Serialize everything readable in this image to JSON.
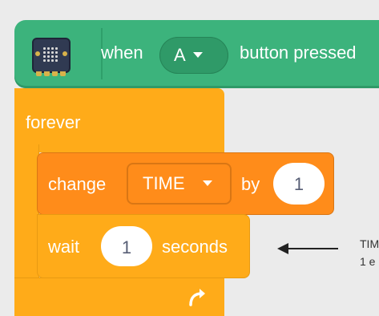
{
  "hat_block": {
    "word_when": "when",
    "button_value": "A",
    "word_button_pressed": "button pressed"
  },
  "forever_block": {
    "label": "forever"
  },
  "change_block": {
    "word_change": "change",
    "variable": "TIME",
    "word_by": "by",
    "value": "1"
  },
  "wait_block": {
    "word_wait": "wait",
    "value": "1",
    "word_seconds": "seconds"
  },
  "annotation": {
    "line1": "TIM",
    "line2": "1 e"
  },
  "icons": {
    "hat": "microbit-board-icon",
    "dropdown": "caret-down-icon",
    "loop": "loop-arrow-icon",
    "annotation": "arrow-left-icon"
  },
  "colors": {
    "events": "#3cb37c",
    "control": "#ffab19",
    "variables": "#ff8c1a",
    "background": "#ebebeb"
  }
}
